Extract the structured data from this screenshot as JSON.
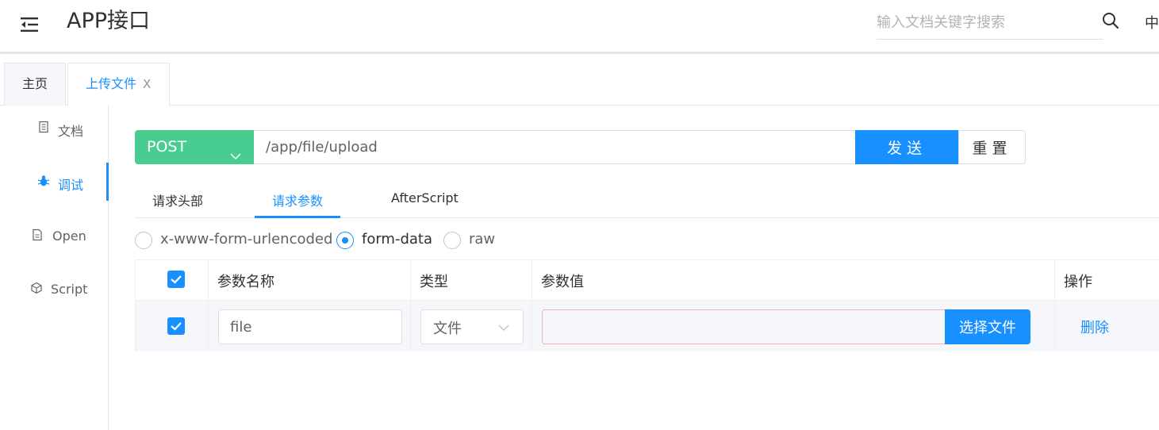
{
  "header": {
    "menu_icon": "menu-fold-icon",
    "title": "APP接口",
    "search_placeholder": "输入文档关键字搜索",
    "search_icon": "search-icon",
    "language": "中"
  },
  "tabs": [
    {
      "label": "主页",
      "active": false
    },
    {
      "label": "上传文件",
      "active": true,
      "close": "X"
    }
  ],
  "sidebar": {
    "items": [
      {
        "label": "文档",
        "icon": "document-icon",
        "active": false
      },
      {
        "label": "调试",
        "icon": "bug-icon",
        "active": true
      },
      {
        "label": "Open",
        "icon": "file-text-icon",
        "active": false
      },
      {
        "label": "Script",
        "icon": "code-sandbox-icon",
        "active": false
      }
    ]
  },
  "request": {
    "method": "POST",
    "url": "/app/file/upload",
    "send_label": "发送",
    "reset_label": "重置",
    "method_color": "#49cc90"
  },
  "inner_tabs": [
    {
      "label": "请求头部",
      "active": false
    },
    {
      "label": "请求参数",
      "active": true
    },
    {
      "label": "AfterScript",
      "active": false
    }
  ],
  "content_types": [
    {
      "label": "x-www-form-urlencoded",
      "selected": false
    },
    {
      "label": "form-data",
      "selected": true
    },
    {
      "label": "raw",
      "selected": false
    }
  ],
  "params_table": {
    "columns": [
      "参数名称",
      "类型",
      "参数值",
      "操作"
    ],
    "header_checked": true,
    "rows": [
      {
        "checked": true,
        "name": "file",
        "type": "文件",
        "value": "",
        "choose_file_label": "选择文件",
        "action": "删除"
      }
    ]
  },
  "colors": {
    "accent": "#1890ff",
    "post": "#49cc90"
  }
}
